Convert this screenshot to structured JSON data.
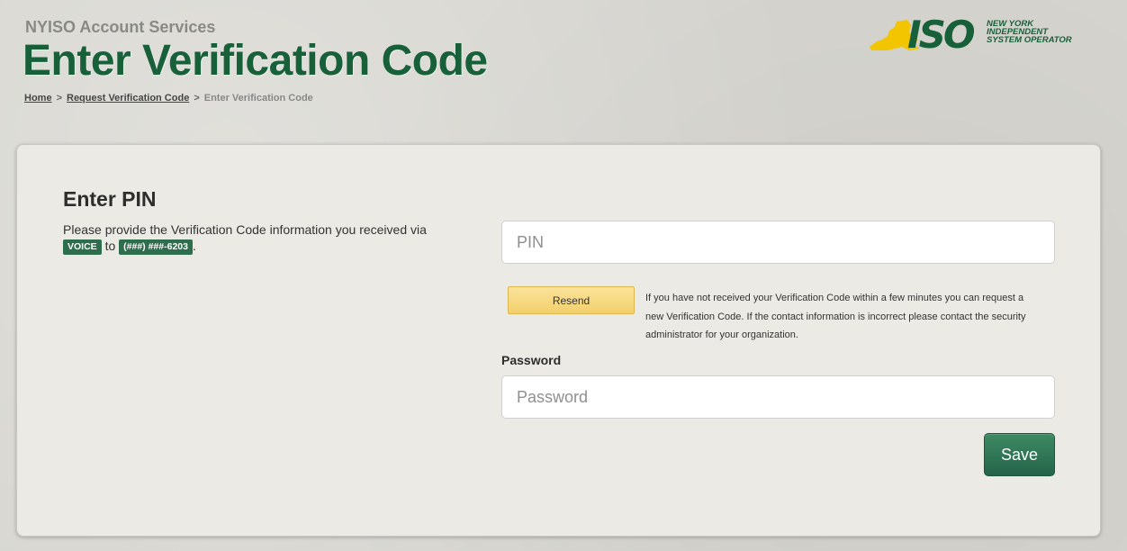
{
  "header": {
    "subtitle": "NYISO Account Services",
    "title": "Enter Verification Code",
    "breadcrumb": [
      {
        "label": "Home"
      },
      {
        "label": "Request Verification Code"
      },
      {
        "label": "Enter Verification Code"
      }
    ],
    "breadcrumb_separator": ">"
  },
  "logo": {
    "mark": "ISO",
    "tagline_line1": "NEW YORK",
    "tagline_line2": "INDEPENDENT",
    "tagline_line3": "SYSTEM OPERATOR",
    "icon": "new-york-state-icon",
    "brand_green": "#17603a",
    "state_yellow": "#f2c500"
  },
  "form": {
    "heading": "Enter PIN",
    "instruction_text": "Please provide the Verification Code information you received via",
    "instruction_to": "to",
    "instruction_end": ".",
    "method_tag": "VOICE",
    "phone_tag": "(###) ###-6203",
    "pin_placeholder": "PIN",
    "resend_label": "Resend",
    "resend_help": "If you have not received your Verification Code within a few minutes you can request a new Verification Code. If the contact information is incorrect please contact the security administrator for your organization.",
    "password_label": "Password",
    "password_placeholder": "Password",
    "save_label": "Save"
  },
  "colors": {
    "accent_green": "#2e6e4d",
    "resend_yellow": "#f3d06c"
  }
}
